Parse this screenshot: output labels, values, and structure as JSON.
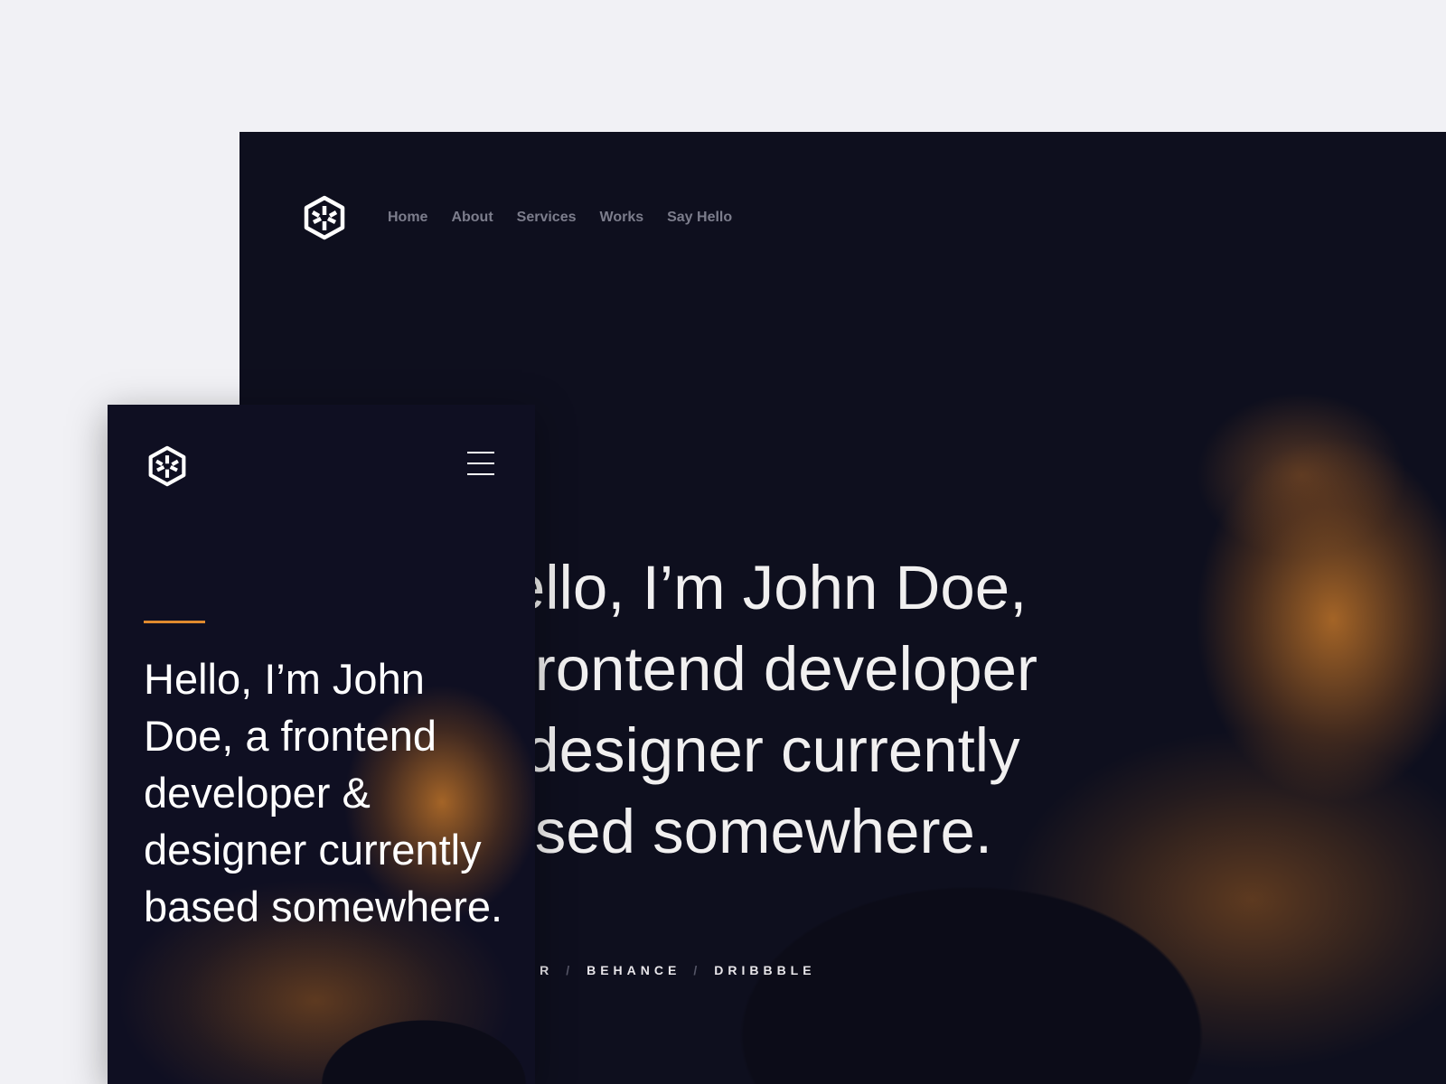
{
  "desktop": {
    "nav": [
      "Home",
      "About",
      "Services",
      "Works",
      "Say Hello"
    ],
    "hero_lines": [
      "Hello, I’m John Doe,",
      "a frontend developer",
      "& designer currently",
      "based somewhere."
    ],
    "social": [
      "Twitter",
      "Behance",
      "Dribbble"
    ],
    "separator": "/"
  },
  "mobile": {
    "hero": "Hello, I’m John Doe, a frontend developer & designer currently based somewhere."
  },
  "colors": {
    "accent": "#e08a2e",
    "background": "#0e0f1e",
    "backdrop": "#d6d9f6"
  }
}
